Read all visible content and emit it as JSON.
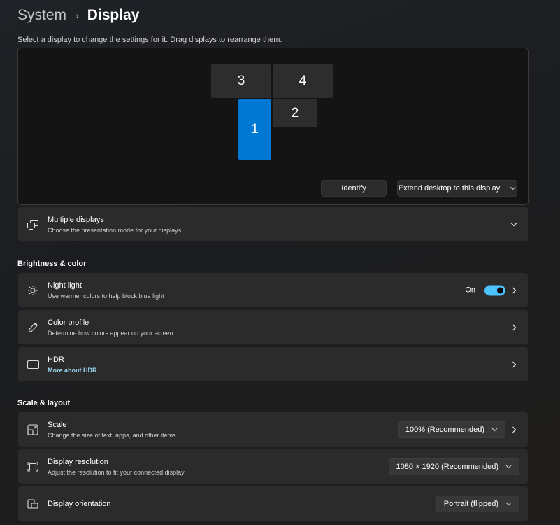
{
  "header": {
    "breadcrumb_parent": "System",
    "breadcrumb_sep": "›",
    "title": "Display"
  },
  "arrange": {
    "instruction": "Select a display to change the settings for it. Drag displays to rearrange them.",
    "monitors": [
      "3",
      "4",
      "2",
      "1"
    ],
    "selected_monitor": "1",
    "identify_label": "Identify",
    "mode_value": "Extend desktop to this display"
  },
  "multiple_displays": {
    "title": "Multiple displays",
    "desc": "Choose the presentation mode for your displays"
  },
  "brightness_color": {
    "header": "Brightness & color",
    "night_light": {
      "title": "Night light",
      "desc": "Use warmer colors to help block blue light",
      "state": "On"
    },
    "color_profile": {
      "title": "Color profile",
      "desc": "Determine how colors appear on your screen"
    },
    "hdr": {
      "title": "HDR",
      "link": "More about HDR",
      "icon_text": "HDR"
    }
  },
  "scale_layout": {
    "header": "Scale & layout",
    "scale": {
      "title": "Scale",
      "desc": "Change the size of text, apps, and other items",
      "value": "100% (Recommended)"
    },
    "resolution": {
      "title": "Display resolution",
      "desc": "Adjust the resolution to fit your connected display",
      "value": "1080 × 1920 (Recommended)"
    },
    "orientation": {
      "title": "Display orientation",
      "value": "Portrait (flipped)"
    }
  },
  "colors": {
    "accent": "#0078d4",
    "toggle_on": "#4cc2ff",
    "link": "#9bd6f0",
    "card_bg": "#2b2b2b"
  }
}
